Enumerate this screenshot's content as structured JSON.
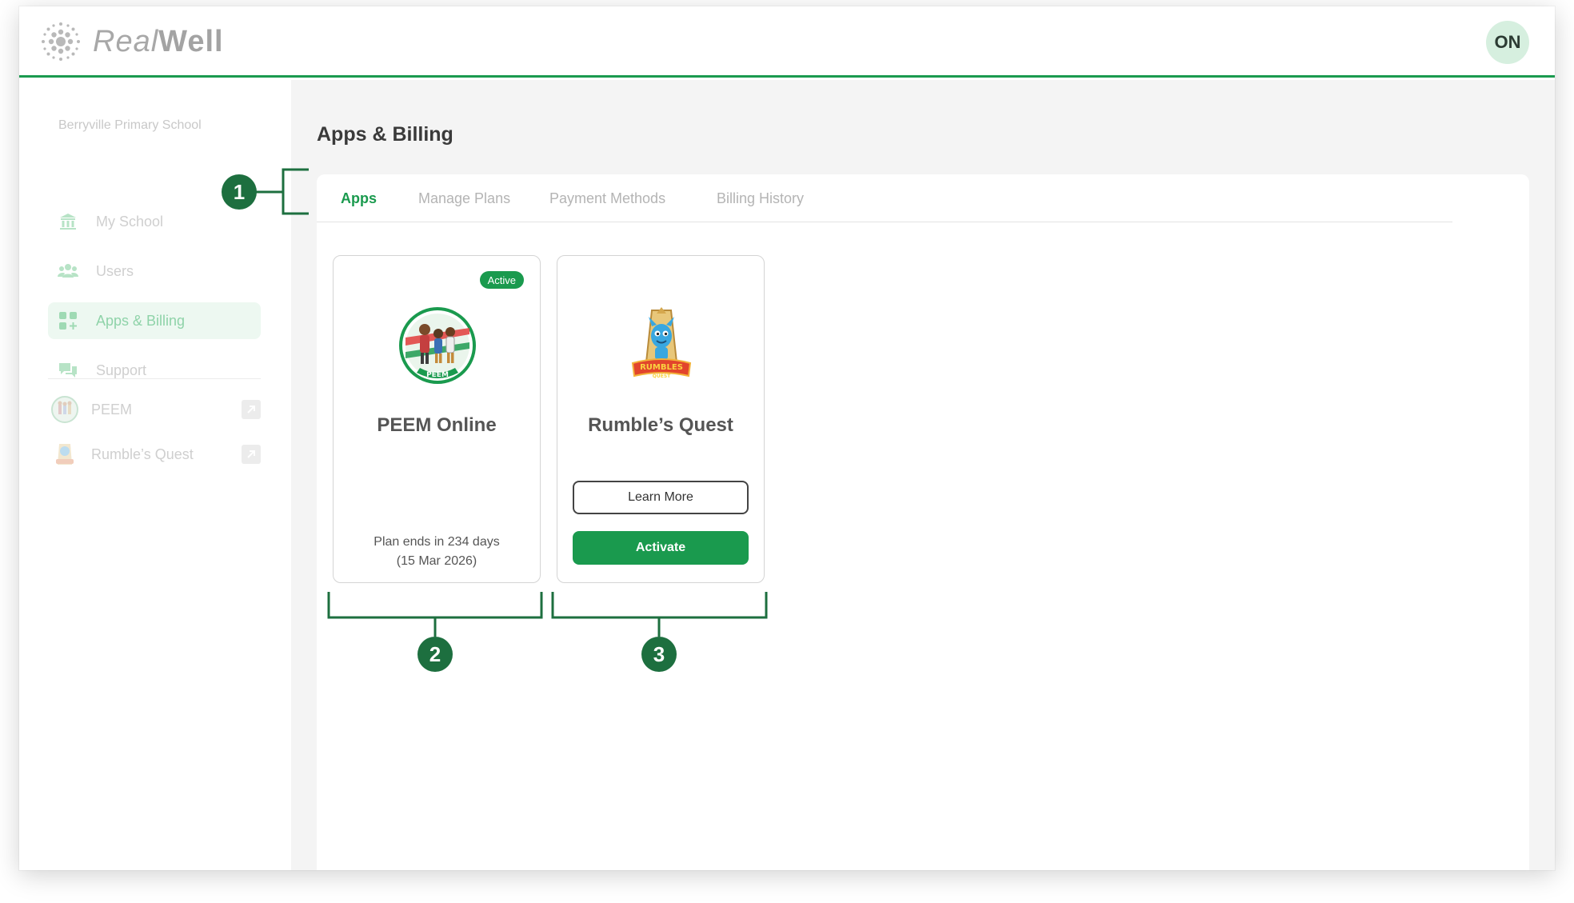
{
  "brand": {
    "logo_light": "Real",
    "logo_bold": "Well"
  },
  "user": {
    "initials": "ON"
  },
  "sidebar": {
    "school_name": "Berryville Primary School",
    "items": [
      {
        "label": "My School",
        "icon": "school-building-icon"
      },
      {
        "label": "Users",
        "icon": "users-group-icon"
      },
      {
        "label": "Apps & Billing",
        "icon": "apps-grid-icon",
        "active": true
      },
      {
        "label": "Support",
        "icon": "chat-bubbles-icon"
      }
    ],
    "apps": [
      {
        "label": "PEEM",
        "icon": "peem-logo-icon"
      },
      {
        "label": "Rumble’s Quest",
        "icon": "rumbles-quest-logo-icon"
      }
    ]
  },
  "main": {
    "title": "Apps & Billing",
    "tabs": [
      {
        "label": "Apps",
        "active": true
      },
      {
        "label": "Manage Plans"
      },
      {
        "label": "Payment Methods"
      },
      {
        "label": "Billing History"
      }
    ],
    "cards": [
      {
        "title": "PEEM Online",
        "badge": "Active",
        "plan_line1": "Plan ends in 234 days",
        "plan_line2": "(15 Mar 2026)"
      },
      {
        "title": "Rumble’s Quest",
        "learn_more": "Learn More",
        "activate": "Activate"
      }
    ]
  },
  "annotations": {
    "m1": "1",
    "m2": "2",
    "m3": "3"
  },
  "colors": {
    "accent": "#1a9a4e",
    "marker": "#1d6f3f",
    "active_bg": "#edf8f1"
  }
}
